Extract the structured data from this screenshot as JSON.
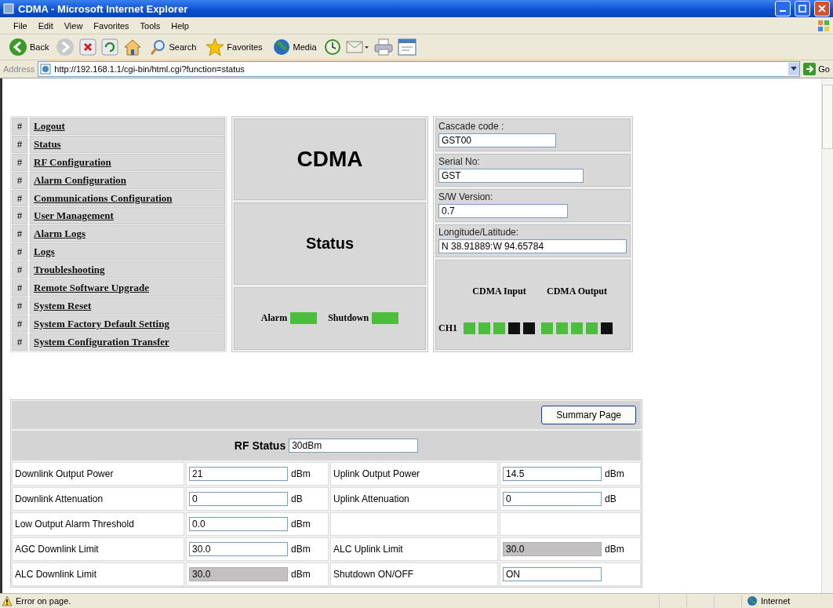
{
  "window": {
    "title": "CDMA - Microsoft Internet Explorer"
  },
  "menu": [
    "File",
    "Edit",
    "View",
    "Favorites",
    "Tools",
    "Help"
  ],
  "toolbar": [
    {
      "kind": "back",
      "label": "Back"
    },
    {
      "kind": "forward"
    },
    {
      "kind": "stop"
    },
    {
      "kind": "refresh"
    },
    {
      "kind": "home"
    },
    {
      "kind": "search",
      "label": "Search"
    },
    {
      "kind": "favorites",
      "label": "Favorites"
    },
    {
      "kind": "media",
      "label": "Media"
    },
    {
      "kind": "history"
    },
    {
      "kind": "mail"
    },
    {
      "kind": "print"
    },
    {
      "kind": "edit"
    }
  ],
  "address": {
    "label": "Address",
    "url": "http://192.168.1.1/cgi-bin/html.cgi?function=status",
    "go": "Go"
  },
  "nav": [
    {
      "mark": "#",
      "label": "Logout"
    },
    {
      "mark": "#",
      "label": "Status"
    },
    {
      "mark": "#",
      "label": "RF Configuration"
    },
    {
      "mark": "#",
      "label": "Alarm Configuration"
    },
    {
      "mark": "#",
      "label": "Communications Configuration"
    },
    {
      "mark": "#",
      "label": "User Management"
    },
    {
      "mark": "#",
      "label": "Alarm Logs"
    },
    {
      "mark": "#",
      "label": "Logs"
    },
    {
      "mark": "#",
      "label": "Troubleshooting"
    },
    {
      "mark": "#",
      "label": "Remote Software Upgrade"
    },
    {
      "mark": "#",
      "label": "System Reset"
    },
    {
      "mark": "#",
      "label": "System Factory Default Setting"
    },
    {
      "mark": "#",
      "label": "System Configuration Transfer"
    }
  ],
  "title_panel": {
    "heading": "CDMA",
    "subheading": "Status"
  },
  "indicators": [
    {
      "label": "Alarm",
      "on": true
    },
    {
      "label": "Shutdown",
      "on": true
    }
  ],
  "info_fields": [
    {
      "label": "Cascade code :",
      "value": "GST00"
    },
    {
      "label": "Serial No:",
      "value": "GST"
    },
    {
      "label": "S/W Version:",
      "value": "0.7"
    },
    {
      "label": "Longitude/Latitude:",
      "value": "N 38.91889:W 94.65784"
    }
  ],
  "channels": {
    "input_label": "CDMA Input",
    "output_label": "CDMA Output",
    "rows": [
      {
        "name": "CH1",
        "input": [
          {
            "on": true
          },
          {
            "on": true
          },
          {
            "on": true
          },
          {
            "on": false
          },
          {
            "on": false
          }
        ],
        "output": [
          {
            "on": true
          },
          {
            "on": true
          },
          {
            "on": true
          },
          {
            "on": true
          },
          {
            "on": false
          }
        ]
      }
    ]
  },
  "rf": {
    "button": "Summary Page",
    "status_label": "RF Status",
    "status_value": "30dBm",
    "rows": [
      {
        "left": {
          "label": "Downlink Output Power",
          "value": "21",
          "unit": "dBm",
          "disabled": false
        },
        "right": {
          "label": "Uplink Output Power",
          "value": "14.5",
          "unit": "dBm",
          "disabled": false
        }
      },
      {
        "left": {
          "label": "Downlink Attenuation",
          "value": "0",
          "unit": "dB",
          "disabled": false
        },
        "right": {
          "label": "Uplink Attenuation",
          "value": "0",
          "unit": "dB",
          "disabled": false
        }
      },
      {
        "left": {
          "label": "Low Output Alarm Threshold",
          "value": "0.0",
          "unit": "dBm",
          "disabled": false
        }
      },
      {
        "left": {
          "label": "AGC Downlink Limit",
          "value": "30.0",
          "unit": "dBm",
          "disabled": false
        },
        "right": {
          "label": "ALC Uplink Limit",
          "value": "30.0",
          "unit": "dBm",
          "disabled": true
        }
      },
      {
        "left": {
          "label": "ALC Downlink Limit",
          "value": "30.0",
          "unit": "dBm",
          "disabled": true
        },
        "right": {
          "label": "Shutdown ON/OFF",
          "value": "ON",
          "disabled": false
        }
      }
    ]
  },
  "status_bar": {
    "message": "Error on page.",
    "zone": "Internet"
  }
}
